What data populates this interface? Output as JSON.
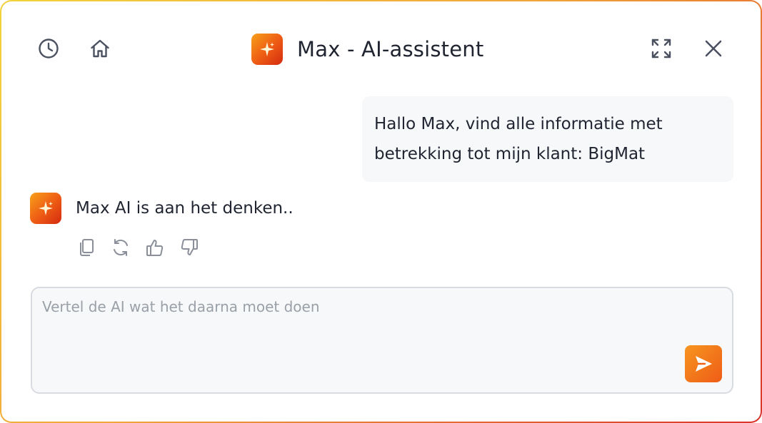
{
  "header": {
    "title": "Max - AI-assistent",
    "icons": {
      "history": "clock-icon",
      "home": "home-icon",
      "expand": "expand-icon",
      "close": "close-icon",
      "logo": "sparkle-logo-icon"
    }
  },
  "conversation": {
    "user_message_line1": "Hallo Max, vind alle informatie met",
    "user_message_line2": "betrekking tot mijn klant: BigMat",
    "ai_status": "Max AI is aan het denken..",
    "actions": [
      "copy-icon",
      "regenerate-icon",
      "thumbs-up-icon",
      "thumbs-down-icon"
    ]
  },
  "input": {
    "value": "",
    "placeholder": "Vertel de AI wat het daarna moet doen",
    "send_icon": "send-icon"
  },
  "colors": {
    "accent": "#ef5f14",
    "border_gradient_start": "#f2d23c",
    "border_gradient_end": "#d9342b",
    "text": "#1f2430",
    "icon": "#4b5160",
    "placeholder": "#9aa0a8"
  }
}
